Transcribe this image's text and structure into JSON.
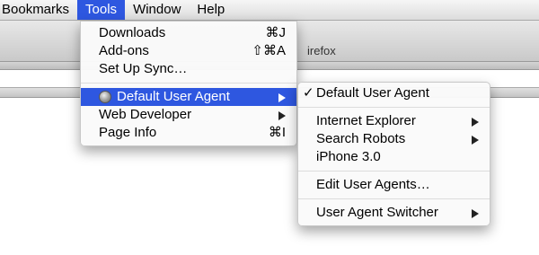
{
  "menubar": {
    "items": [
      {
        "label": "Bookmarks"
      },
      {
        "label": "Tools"
      },
      {
        "label": "Window"
      },
      {
        "label": "Help"
      }
    ]
  },
  "window": {
    "title_fragment": "irefox"
  },
  "tools_menu": {
    "items": [
      {
        "label": "Downloads",
        "shortcut": "⌘J"
      },
      {
        "label": "Add-ons",
        "shortcut": "⇧⌘A"
      },
      {
        "label": "Set Up Sync…"
      },
      {
        "label": "Default User Agent",
        "icon": "user-agent-globe-icon",
        "submenu": true
      },
      {
        "label": "Web Developer",
        "submenu": true
      },
      {
        "label": "Page Info",
        "shortcut": "⌘I"
      }
    ]
  },
  "ua_submenu": {
    "checkmark": "✓",
    "items": [
      {
        "label": "Default User Agent",
        "checked": true
      },
      {
        "label": "Internet Explorer",
        "submenu": true
      },
      {
        "label": "Search Robots",
        "submenu": true
      },
      {
        "label": "iPhone 3.0"
      },
      {
        "label": "Edit User Agents…"
      },
      {
        "label": "User Agent Switcher",
        "submenu": true
      }
    ]
  },
  "colors": {
    "highlight": "#2e57e0"
  }
}
